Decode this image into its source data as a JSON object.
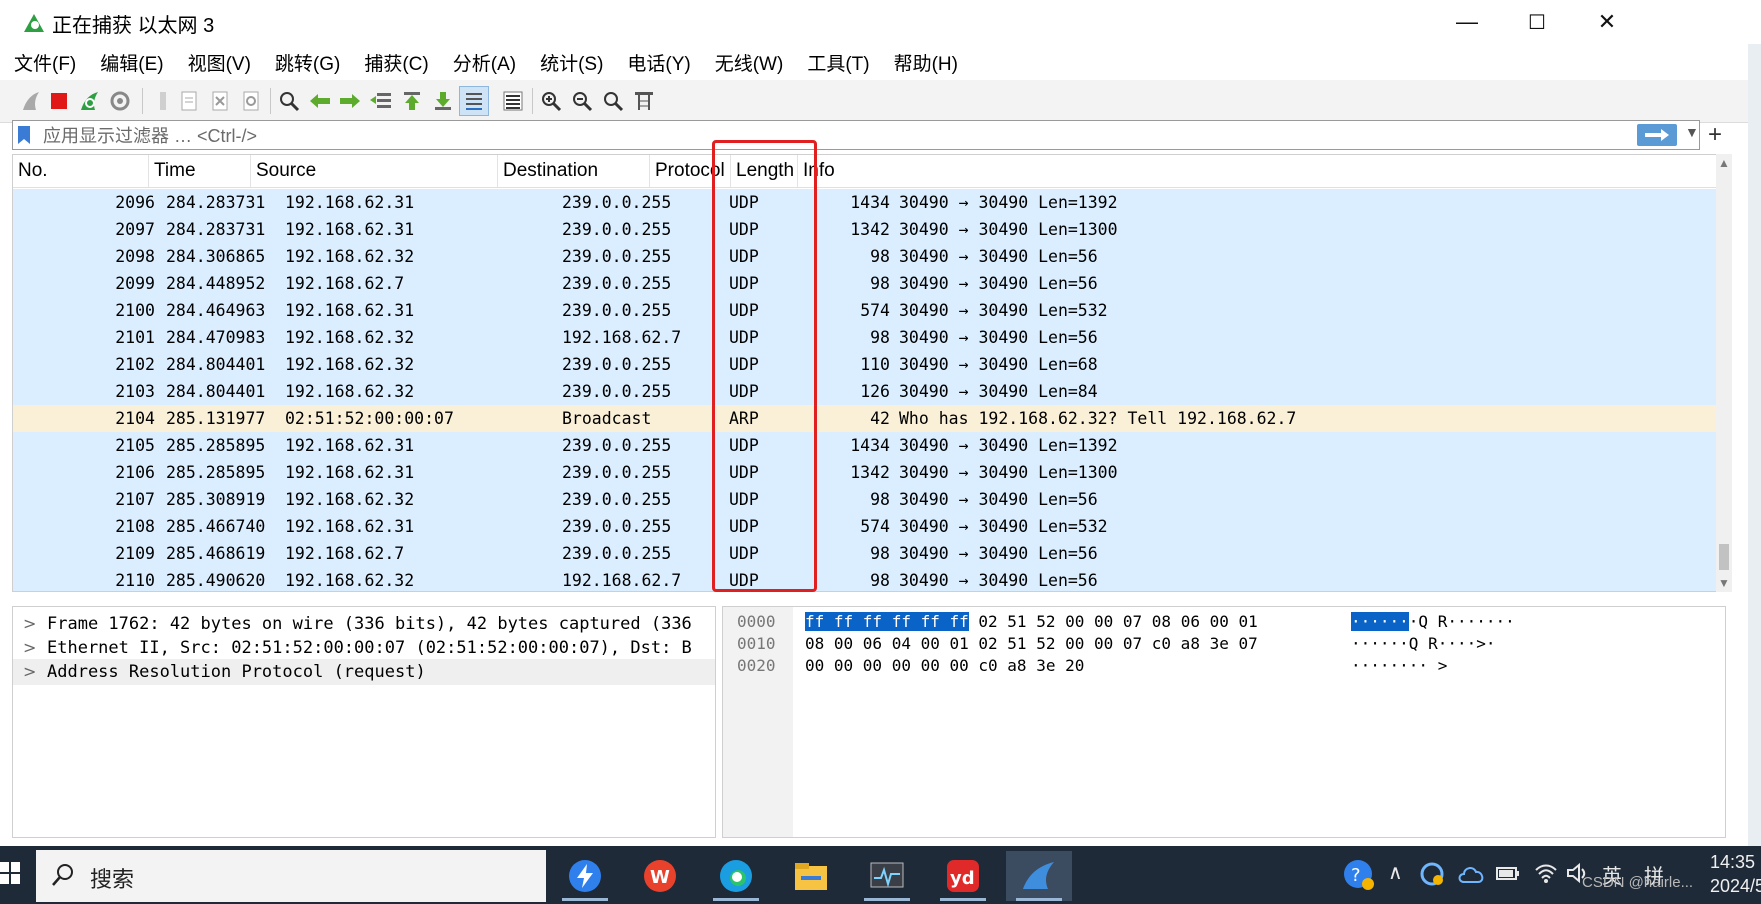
{
  "window": {
    "title": "正在捕获 以太网 3",
    "minimize": "—",
    "maximize": "☐",
    "close": "✕"
  },
  "menu": [
    "文件(F)",
    "编辑(E)",
    "视图(V)",
    "跳转(G)",
    "捕获(C)",
    "分析(A)",
    "统计(S)",
    "电话(Y)",
    "无线(W)",
    "工具(T)",
    "帮助(H)"
  ],
  "toolbar_icons": [
    "shark-fin-start-icon",
    "stop-capture-icon",
    "restart-capture-icon",
    "capture-options-icon",
    "open-file-icon",
    "save-file-icon",
    "close-file-icon",
    "reload-file-icon",
    "find-packet-icon",
    "go-back-icon",
    "go-forward-icon",
    "go-to-packet-icon",
    "go-first-icon",
    "go-last-icon",
    "autoscroll-icon",
    "colorize-icon",
    "zoom-in-icon",
    "zoom-out-icon",
    "zoom-normal-icon",
    "resize-columns-icon"
  ],
  "filter": {
    "placeholder": "应用显示过滤器 … <Ctrl-/>",
    "add": "+"
  },
  "columns": [
    "No.",
    "Time",
    "Source",
    "Destination",
    "Protocol",
    "Length",
    "Info"
  ],
  "packets": [
    {
      "no": "2096",
      "time": "284.283731",
      "src": "192.168.62.31",
      "dst": "239.0.0.255",
      "proto": "UDP",
      "len": "1434",
      "info": "30490 → 30490 Len=1392",
      "type": "udp"
    },
    {
      "no": "2097",
      "time": "284.283731",
      "src": "192.168.62.31",
      "dst": "239.0.0.255",
      "proto": "UDP",
      "len": "1342",
      "info": "30490 → 30490 Len=1300",
      "type": "udp"
    },
    {
      "no": "2098",
      "time": "284.306865",
      "src": "192.168.62.32",
      "dst": "239.0.0.255",
      "proto": "UDP",
      "len": "98",
      "info": "30490 → 30490 Len=56",
      "type": "udp"
    },
    {
      "no": "2099",
      "time": "284.448952",
      "src": "192.168.62.7",
      "dst": "239.0.0.255",
      "proto": "UDP",
      "len": "98",
      "info": "30490 → 30490 Len=56",
      "type": "udp"
    },
    {
      "no": "2100",
      "time": "284.464963",
      "src": "192.168.62.31",
      "dst": "239.0.0.255",
      "proto": "UDP",
      "len": "574",
      "info": "30490 → 30490 Len=532",
      "type": "udp"
    },
    {
      "no": "2101",
      "time": "284.470983",
      "src": "192.168.62.32",
      "dst": "192.168.62.7",
      "proto": "UDP",
      "len": "98",
      "info": "30490 → 30490 Len=56",
      "type": "udp"
    },
    {
      "no": "2102",
      "time": "284.804401",
      "src": "192.168.62.32",
      "dst": "239.0.0.255",
      "proto": "UDP",
      "len": "110",
      "info": "30490 → 30490 Len=68",
      "type": "udp"
    },
    {
      "no": "2103",
      "time": "284.804401",
      "src": "192.168.62.32",
      "dst": "239.0.0.255",
      "proto": "UDP",
      "len": "126",
      "info": "30490 → 30490 Len=84",
      "type": "udp"
    },
    {
      "no": "2104",
      "time": "285.131977",
      "src": "02:51:52:00:00:07",
      "dst": "Broadcast",
      "proto": "ARP",
      "len": "42",
      "info": "Who has 192.168.62.32? Tell 192.168.62.7",
      "type": "arp"
    },
    {
      "no": "2105",
      "time": "285.285895",
      "src": "192.168.62.31",
      "dst": "239.0.0.255",
      "proto": "UDP",
      "len": "1434",
      "info": "30490 → 30490 Len=1392",
      "type": "udp"
    },
    {
      "no": "2106",
      "time": "285.285895",
      "src": "192.168.62.31",
      "dst": "239.0.0.255",
      "proto": "UDP",
      "len": "1342",
      "info": "30490 → 30490 Len=1300",
      "type": "udp"
    },
    {
      "no": "2107",
      "time": "285.308919",
      "src": "192.168.62.32",
      "dst": "239.0.0.255",
      "proto": "UDP",
      "len": "98",
      "info": "30490 → 30490 Len=56",
      "type": "udp"
    },
    {
      "no": "2108",
      "time": "285.466740",
      "src": "192.168.62.31",
      "dst": "239.0.0.255",
      "proto": "UDP",
      "len": "574",
      "info": "30490 → 30490 Len=532",
      "type": "udp"
    },
    {
      "no": "2109",
      "time": "285.468619",
      "src": "192.168.62.7",
      "dst": "239.0.0.255",
      "proto": "UDP",
      "len": "98",
      "info": "30490 → 30490 Len=56",
      "type": "udp"
    },
    {
      "no": "2110",
      "time": "285.490620",
      "src": "192.168.62.32",
      "dst": "192.168.62.7",
      "proto": "UDP",
      "len": "98",
      "info": "30490 → 30490 Len=56",
      "type": "udp"
    }
  ],
  "row_colors": {
    "udp": "#daeeff",
    "arp": "#faf0d7"
  },
  "details": [
    "Frame 1762: 42 bytes on wire (336 bits), 42 bytes captured (336",
    "Ethernet II, Src: 02:51:52:00:00:07 (02:51:52:00:00:07), Dst: B",
    "Address Resolution Protocol (request)"
  ],
  "bytes": [
    {
      "offset": "0000",
      "hex_hl": "ff ff ff ff ff ff",
      "hex_rest": " 02 51  52 00 00 07 08 06 00 01",
      "ascii_hl": "······",
      "ascii_rest": "·Q R·······"
    },
    {
      "offset": "0010",
      "hex_hl": "",
      "hex_rest": "08 00 06 04 00 01 02 51  52 00 00 07 c0 a8 3e 07",
      "ascii_hl": "",
      "ascii_rest": "······Q R····>·"
    },
    {
      "offset": "0020",
      "hex_hl": "",
      "hex_rest": "00 00 00 00 00 00 c0 a8  3e 20",
      "ascii_hl": "",
      "ascii_rest": "········ >"
    }
  ],
  "taskbar": {
    "search": "搜索",
    "apps": [
      "feishu-icon",
      "wps-icon",
      "edge-icon",
      "file-explorer-icon",
      "monitor-icon",
      "youdao-icon",
      "wireshark-icon"
    ],
    "tray_ime": "英",
    "tray_ime2": "拼",
    "time": "14:35",
    "date": "2024/5/",
    "watermark": "CSDN @hairle..."
  }
}
